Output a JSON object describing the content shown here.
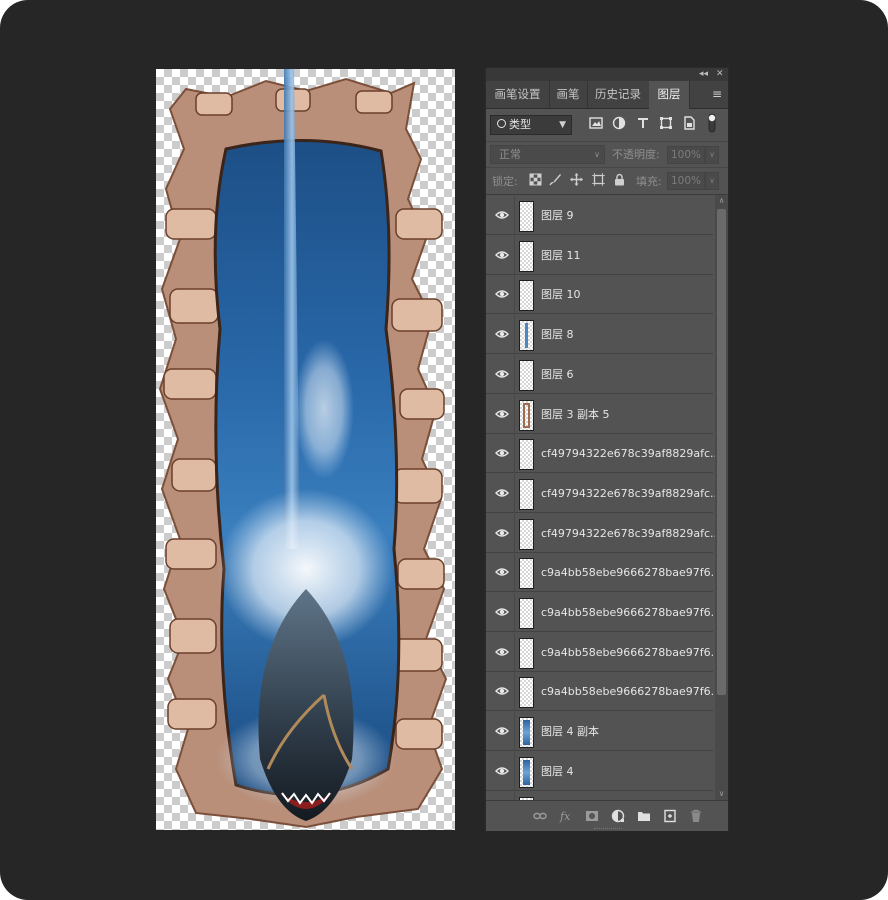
{
  "panel": {
    "tabs": [
      {
        "label": "画笔设置",
        "active": false
      },
      {
        "label": "画笔",
        "active": false
      },
      {
        "label": "历史记录",
        "active": false
      },
      {
        "label": "图层",
        "active": true
      }
    ],
    "collapse_glyph": "◂◂",
    "close_glyph": "✕",
    "menu_glyph": "≡",
    "filter": {
      "kind_label": "类型",
      "icons": [
        "image-filter-icon",
        "adjustment-filter-icon",
        "type-filter-icon",
        "shape-filter-icon",
        "smart-object-filter-icon",
        "filter-toggle-icon"
      ]
    },
    "blend_mode": "正常",
    "opacity_label": "不透明度:",
    "opacity_value": "100%",
    "lock_label": "锁定:",
    "fill_label": "填充:",
    "fill_value": "100%",
    "layers": [
      {
        "name": "图层 9",
        "visible": true,
        "thumb": "empty"
      },
      {
        "name": "图层 11",
        "visible": true,
        "thumb": "empty"
      },
      {
        "name": "图层 10",
        "visible": true,
        "thumb": "empty"
      },
      {
        "name": "图层 8",
        "visible": true,
        "thumb": "stripe"
      },
      {
        "name": "图层 6",
        "visible": true,
        "thumb": "empty"
      },
      {
        "name": "图层 3 副本 5",
        "visible": true,
        "thumb": "frame"
      },
      {
        "name": "cf49794322e678c39af8829afc...",
        "visible": true,
        "thumb": "empty"
      },
      {
        "name": "cf49794322e678c39af8829afc...",
        "visible": true,
        "thumb": "empty"
      },
      {
        "name": "cf49794322e678c39af8829afc...",
        "visible": true,
        "thumb": "empty"
      },
      {
        "name": "c9a4bb58ebe9666278bae97f6...",
        "visible": true,
        "thumb": "empty"
      },
      {
        "name": "c9a4bb58ebe9666278bae97f6...",
        "visible": true,
        "thumb": "empty"
      },
      {
        "name": "c9a4bb58ebe9666278bae97f6...",
        "visible": true,
        "thumb": "empty"
      },
      {
        "name": "c9a4bb58ebe9666278bae97f6...",
        "visible": true,
        "thumb": "empty"
      },
      {
        "name": "图层 4 副本",
        "visible": true,
        "thumb": "water"
      },
      {
        "name": "图层 4",
        "visible": true,
        "thumb": "water"
      },
      {
        "name": "",
        "visible": false,
        "thumb": "empty"
      }
    ],
    "footer_buttons": [
      "link-layers-icon",
      "fx-icon",
      "add-mask-icon",
      "new-adjustment-icon",
      "new-group-icon",
      "new-layer-icon",
      "delete-layer-icon"
    ]
  },
  "colors": {
    "background": "#262626",
    "panel": "#535353",
    "tab_bar": "#424242",
    "text": "#e6e6e6"
  }
}
